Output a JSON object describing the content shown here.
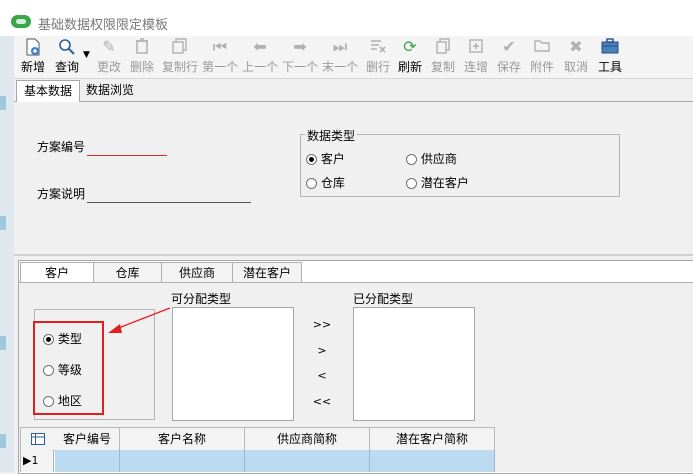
{
  "window": {
    "title": "基础数据权限限定模板"
  },
  "toolbar": {
    "items": [
      {
        "label": "新增",
        "icon": "new-doc-icon",
        "enabled": true
      },
      {
        "label": "查询",
        "icon": "search-icon",
        "enabled": true
      },
      {
        "label": "更改",
        "icon": "pencil-icon",
        "enabled": false
      },
      {
        "label": "删除",
        "icon": "trash-icon",
        "enabled": false
      },
      {
        "label": "复制行",
        "icon": "copy-row-icon",
        "enabled": false
      },
      {
        "label": "第一个",
        "icon": "first-icon",
        "enabled": false
      },
      {
        "label": "上一个",
        "icon": "prev-icon",
        "enabled": false
      },
      {
        "label": "下一个",
        "icon": "next-icon",
        "enabled": false
      },
      {
        "label": "末一个",
        "icon": "last-icon",
        "enabled": false
      },
      {
        "label": "删行",
        "icon": "delete-row-icon",
        "enabled": false
      },
      {
        "label": "刷新",
        "icon": "refresh-icon",
        "enabled": true
      },
      {
        "label": "复制",
        "icon": "copy-icon",
        "enabled": false
      },
      {
        "label": "连增",
        "icon": "add-continuous-icon",
        "enabled": false
      },
      {
        "label": "保存",
        "icon": "check-icon",
        "enabled": false
      },
      {
        "label": "附件",
        "icon": "folder-icon",
        "enabled": false
      },
      {
        "label": "取消",
        "icon": "close-icon",
        "enabled": false
      },
      {
        "label": "工具",
        "icon": "toolbox-icon",
        "enabled": true
      }
    ]
  },
  "tabs": {
    "basic": "基本数据",
    "browse": "数据浏览"
  },
  "form": {
    "scheme_no_label": "方案编号",
    "scheme_desc_label": "方案说明",
    "data_type": {
      "title": "数据类型",
      "options": [
        "客户",
        "供应商",
        "仓库",
        "潜在客户"
      ],
      "selected": "客户"
    }
  },
  "subtabs": [
    "客户",
    "仓库",
    "供应商",
    "潜在客户"
  ],
  "assign": {
    "type_options": [
      "类型",
      "等级",
      "地区"
    ],
    "selected_type": "类型",
    "available_title": "可分配类型",
    "assigned_title": "已分配类型",
    "move_buttons": [
      ">>",
      ">",
      "<",
      "<<"
    ]
  },
  "grid": {
    "columns": [
      "客户编号",
      "客户名称",
      "供应商简称",
      "潜在客户简称"
    ],
    "row_indicator": "▶1"
  },
  "colors": {
    "highlight": "#e02020",
    "row_selected": "#bcdaf0"
  }
}
